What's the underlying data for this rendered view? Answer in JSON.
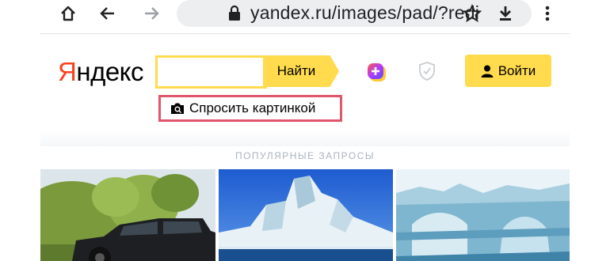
{
  "browser": {
    "url": "yandex.ru/images/pad/?redi",
    "icons": [
      "home-icon",
      "back-icon",
      "forward-icon",
      "reload-icon",
      "lock-icon",
      "star-icon",
      "download-icon",
      "menu-icon"
    ]
  },
  "yandex": {
    "logo_first": "Я",
    "logo_rest": "ндекс",
    "search_value": "",
    "search_button": "Найти",
    "login_button": "Войти",
    "ask_by_picture": "Спросить картинкой",
    "popular_queries": "ПОПУЛЯРНЫЕ ЗАПРОСЫ"
  },
  "colors": {
    "brand_yellow": "#ffdb4d",
    "logo_red": "#fc3f1d",
    "highlight_border": "#e0566a"
  },
  "tiles": [
    {
      "subject": "black SUV near trees"
    },
    {
      "subject": "iceberg under blue sky"
    },
    {
      "subject": "ice arch iceberg"
    }
  ]
}
